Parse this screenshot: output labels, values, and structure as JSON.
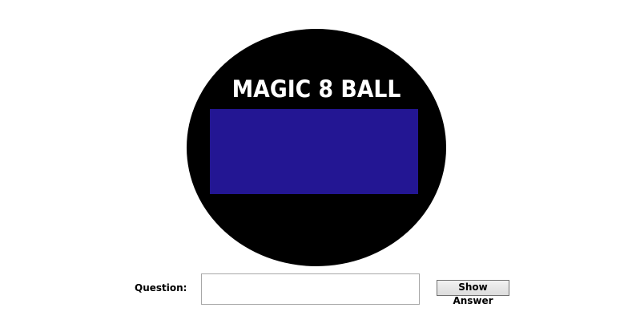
{
  "ball": {
    "title": "MAGIC 8 BALL",
    "answer": "",
    "colors": {
      "ball": "#000000",
      "title": "#ffffff",
      "answer_window": "#231693"
    }
  },
  "form": {
    "question_label": "Question:",
    "question_value": "",
    "show_answer_label": "Show Answer"
  }
}
